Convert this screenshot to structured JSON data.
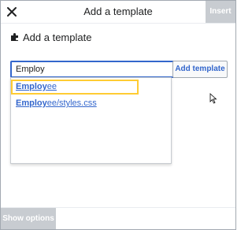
{
  "dialog": {
    "title": "Add a template",
    "insert_label": "Insert",
    "heading": "Add a template",
    "search": {
      "value": "Employ"
    },
    "add_button_label": "Add template",
    "suggestions": [
      {
        "match": "Employ",
        "rest": "ee",
        "highlighted": true
      },
      {
        "match": "Employ",
        "rest": "ee/styles.css",
        "highlighted": false
      }
    ],
    "footer": {
      "show_options_label": "Show options"
    }
  },
  "icons": {
    "close": "close-icon",
    "heading": "puzzle-icon",
    "cursor": "mouse-pointer-icon"
  },
  "colors": {
    "accent": "#3366cc",
    "disabled": "#c8ccd1",
    "focus_outline": "#ffcc33"
  }
}
